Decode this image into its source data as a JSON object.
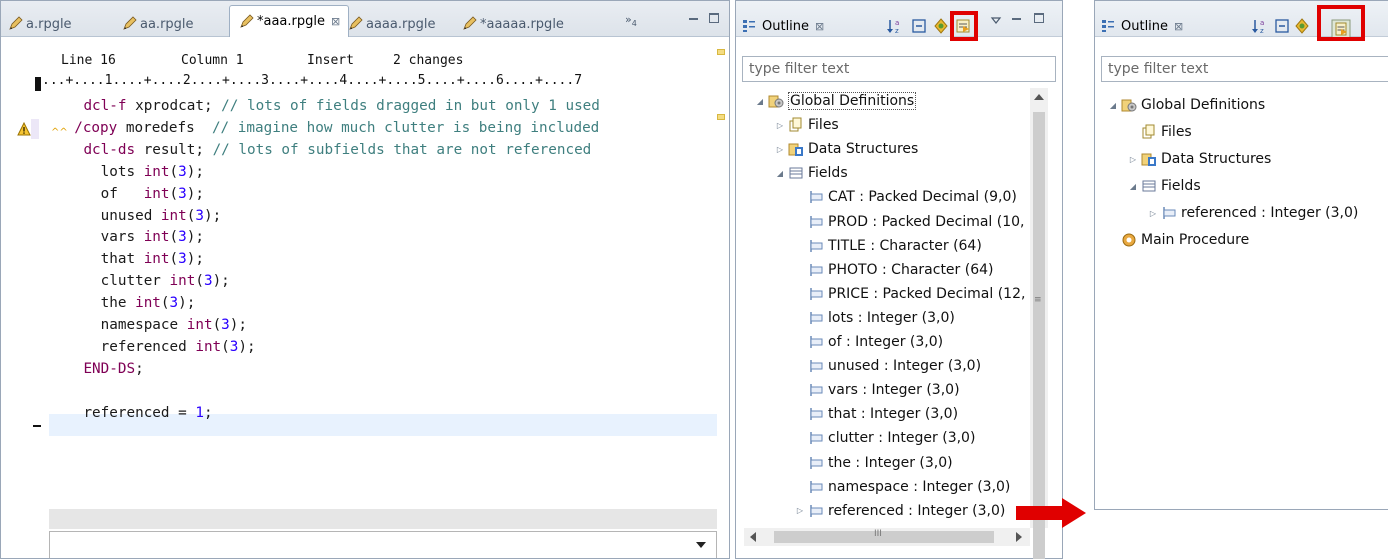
{
  "editor": {
    "tabs": [
      {
        "label": "a.rpgle",
        "active": false
      },
      {
        "label": "aa.rpgle",
        "active": false
      },
      {
        "label": "*aaa.rpgle",
        "active": true
      },
      {
        "label": "aaaa.rpgle",
        "active": false
      },
      {
        "label": "*aaaaa.rpgle",
        "active": false
      }
    ],
    "tab_overflow": "»",
    "tab_overflow_count": "4",
    "close_glyph": "⊠",
    "status": {
      "line": "Line 16",
      "column": "Column 1",
      "mode": "Insert",
      "changes": "2 changes"
    },
    "ruler": "...+....1....+....2....+....3....+....4....+....5....+....6....+....7",
    "code": [
      {
        "indent": "  ",
        "parts": [
          {
            "t": "dcl-f",
            "c": "kw"
          },
          {
            "t": " xprodcat; ",
            "c": ""
          },
          {
            "t": "// lots of fields dragged in but only 1 used",
            "c": "cm"
          }
        ]
      },
      {
        "indent": "",
        "parts": [
          {
            "t": "/copy",
            "c": "kw"
          },
          {
            "t": " moredefs  ",
            "c": ""
          },
          {
            "t": "// imagine how much clutter is being included",
            "c": "cm"
          }
        ]
      },
      {
        "indent": "  ",
        "parts": [
          {
            "t": "dcl-ds",
            "c": "kw"
          },
          {
            "t": " result; ",
            "c": ""
          },
          {
            "t": "// lots of subfields that are not referenced",
            "c": "cm"
          }
        ]
      },
      {
        "indent": "    ",
        "parts": [
          {
            "t": "lots ",
            "c": ""
          },
          {
            "t": "int",
            "c": "kw"
          },
          {
            "t": "(",
            "c": ""
          },
          {
            "t": "3",
            "c": "num"
          },
          {
            "t": ");",
            "c": ""
          }
        ]
      },
      {
        "indent": "    ",
        "parts": [
          {
            "t": "of   ",
            "c": ""
          },
          {
            "t": "int",
            "c": "kw"
          },
          {
            "t": "(",
            "c": ""
          },
          {
            "t": "3",
            "c": "num"
          },
          {
            "t": ");",
            "c": ""
          }
        ]
      },
      {
        "indent": "    ",
        "parts": [
          {
            "t": "unused ",
            "c": ""
          },
          {
            "t": "int",
            "c": "kw"
          },
          {
            "t": "(",
            "c": ""
          },
          {
            "t": "3",
            "c": "num"
          },
          {
            "t": ");",
            "c": ""
          }
        ]
      },
      {
        "indent": "    ",
        "parts": [
          {
            "t": "vars ",
            "c": ""
          },
          {
            "t": "int",
            "c": "kw"
          },
          {
            "t": "(",
            "c": ""
          },
          {
            "t": "3",
            "c": "num"
          },
          {
            "t": ");",
            "c": ""
          }
        ]
      },
      {
        "indent": "    ",
        "parts": [
          {
            "t": "that ",
            "c": ""
          },
          {
            "t": "int",
            "c": "kw"
          },
          {
            "t": "(",
            "c": ""
          },
          {
            "t": "3",
            "c": "num"
          },
          {
            "t": ");",
            "c": ""
          }
        ]
      },
      {
        "indent": "    ",
        "parts": [
          {
            "t": "clutter ",
            "c": ""
          },
          {
            "t": "int",
            "c": "kw"
          },
          {
            "t": "(",
            "c": ""
          },
          {
            "t": "3",
            "c": "num"
          },
          {
            "t": ");",
            "c": ""
          }
        ]
      },
      {
        "indent": "    ",
        "parts": [
          {
            "t": "the ",
            "c": ""
          },
          {
            "t": "int",
            "c": "kw"
          },
          {
            "t": "(",
            "c": ""
          },
          {
            "t": "3",
            "c": "num"
          },
          {
            "t": ");",
            "c": ""
          }
        ]
      },
      {
        "indent": "    ",
        "parts": [
          {
            "t": "namespace ",
            "c": ""
          },
          {
            "t": "int",
            "c": "kw"
          },
          {
            "t": "(",
            "c": ""
          },
          {
            "t": "3",
            "c": "num"
          },
          {
            "t": ");",
            "c": ""
          }
        ]
      },
      {
        "indent": "    ",
        "parts": [
          {
            "t": "referenced ",
            "c": ""
          },
          {
            "t": "int",
            "c": "kw"
          },
          {
            "t": "(",
            "c": ""
          },
          {
            "t": "3",
            "c": "num"
          },
          {
            "t": ");",
            "c": ""
          }
        ]
      },
      {
        "indent": "  ",
        "parts": [
          {
            "t": "END-DS",
            "c": "kw"
          },
          {
            "t": ";",
            "c": ""
          }
        ]
      },
      {
        "indent": "",
        "parts": []
      },
      {
        "indent": "  ",
        "parts": [
          {
            "t": "referenced = ",
            "c": ""
          },
          {
            "t": "1",
            "c": "num"
          },
          {
            "t": ";",
            "c": ""
          }
        ]
      }
    ]
  },
  "outline_before": {
    "title": "Outline",
    "filter_placeholder": "type filter text",
    "tree": [
      {
        "label": "Global Definitions",
        "level": 0,
        "twisty": "open",
        "icon": "global-definitions-icon",
        "selected": true
      },
      {
        "label": "Files",
        "level": 1,
        "twisty": "closed",
        "icon": "files-icon"
      },
      {
        "label": "Data Structures",
        "level": 1,
        "twisty": "closed",
        "icon": "data-structures-icon"
      },
      {
        "label": "Fields",
        "level": 1,
        "twisty": "open",
        "icon": "fields-icon"
      },
      {
        "label": "CAT : Packed Decimal (9,0)",
        "level": 2,
        "twisty": "none",
        "icon": "field-icon"
      },
      {
        "label": "PROD : Packed Decimal (10,",
        "level": 2,
        "twisty": "none",
        "icon": "field-icon"
      },
      {
        "label": "TITLE : Character (64)",
        "level": 2,
        "twisty": "none",
        "icon": "field-icon"
      },
      {
        "label": "PHOTO : Character (64)",
        "level": 2,
        "twisty": "none",
        "icon": "field-icon"
      },
      {
        "label": "PRICE : Packed Decimal (12,",
        "level": 2,
        "twisty": "none",
        "icon": "field-icon"
      },
      {
        "label": "lots : Integer (3,0)",
        "level": 2,
        "twisty": "none",
        "icon": "field-icon"
      },
      {
        "label": "of : Integer (3,0)",
        "level": 2,
        "twisty": "none",
        "icon": "field-icon"
      },
      {
        "label": "unused : Integer (3,0)",
        "level": 2,
        "twisty": "none",
        "icon": "field-icon"
      },
      {
        "label": "vars : Integer (3,0)",
        "level": 2,
        "twisty": "none",
        "icon": "field-icon"
      },
      {
        "label": "that : Integer (3,0)",
        "level": 2,
        "twisty": "none",
        "icon": "field-icon"
      },
      {
        "label": "clutter : Integer (3,0)",
        "level": 2,
        "twisty": "none",
        "icon": "field-icon"
      },
      {
        "label": "the : Integer (3,0)",
        "level": 2,
        "twisty": "none",
        "icon": "field-icon"
      },
      {
        "label": "namespace : Integer (3,0)",
        "level": 2,
        "twisty": "none",
        "icon": "field-icon"
      },
      {
        "label": "referenced : Integer (3,0)",
        "level": 2,
        "twisty": "closed",
        "icon": "field-icon"
      }
    ],
    "hscroll_glyph": "III"
  },
  "outline_after": {
    "title": "Outline",
    "filter_placeholder": "type filter text",
    "tree": [
      {
        "label": "Global Definitions",
        "level": 0,
        "twisty": "open",
        "icon": "global-definitions-icon"
      },
      {
        "label": "Files",
        "level": 1,
        "twisty": "none",
        "icon": "files-icon"
      },
      {
        "label": "Data Structures",
        "level": 1,
        "twisty": "closed",
        "icon": "data-structures-icon"
      },
      {
        "label": "Fields",
        "level": 1,
        "twisty": "open",
        "icon": "fields-icon"
      },
      {
        "label": "referenced : Integer (3,0)",
        "level": 2,
        "twisty": "closed",
        "icon": "field-icon"
      },
      {
        "label": "Main Procedure",
        "level": 0,
        "twisty": "none",
        "icon": "main-procedure-icon"
      }
    ]
  },
  "colors": {
    "keyword": "#7f0055",
    "comment": "#3f7f7f",
    "number": "#2a00ff",
    "highlight_box": "#e00000",
    "arrow": "#e00000",
    "current_line": "#e8f2fe"
  }
}
